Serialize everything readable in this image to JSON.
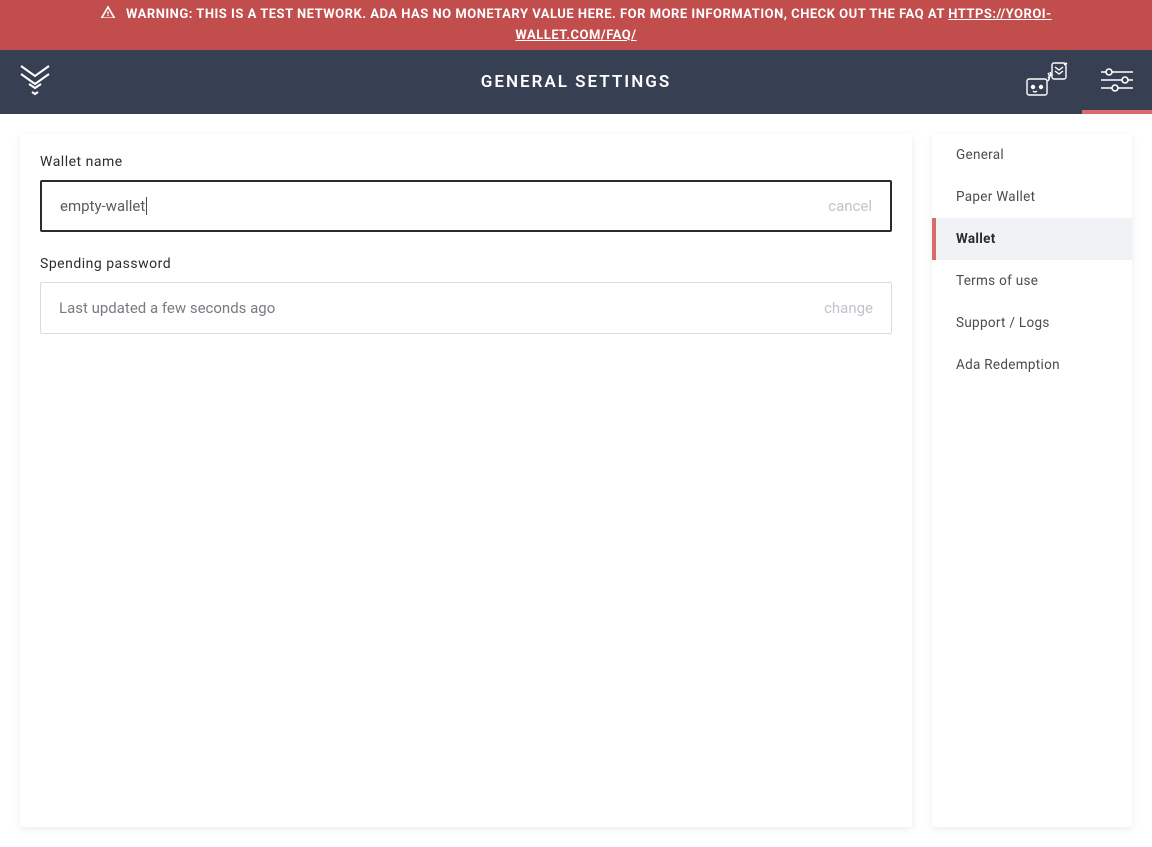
{
  "warning": {
    "text_prefix": "WARNING: THIS IS A TEST NETWORK. ADA HAS NO MONETARY VALUE HERE. FOR MORE INFORMATION, CHECK OUT THE FAQ AT ",
    "link_text": "HTTPS://YOROI-WALLET.COM/FAQ/",
    "link_href": "https://yoroi-wallet.com/faq/"
  },
  "header": {
    "title": "GENERAL SETTINGS"
  },
  "colors": {
    "warning_bg": "#C14D4C",
    "header_bg": "#373F52",
    "accent": "#DB6B6A"
  },
  "main": {
    "wallet_name": {
      "label": "Wallet name",
      "value": "empty-wallet",
      "action": "cancel"
    },
    "spending_password": {
      "label": "Spending password",
      "value": "Last updated a few seconds ago",
      "action": "change"
    }
  },
  "sidebar": {
    "items": [
      {
        "label": "General",
        "active": false
      },
      {
        "label": "Paper Wallet",
        "active": false
      },
      {
        "label": "Wallet",
        "active": true
      },
      {
        "label": "Terms of use",
        "active": false
      },
      {
        "label": "Support / Logs",
        "active": false
      },
      {
        "label": "Ada Redemption",
        "active": false
      }
    ]
  }
}
